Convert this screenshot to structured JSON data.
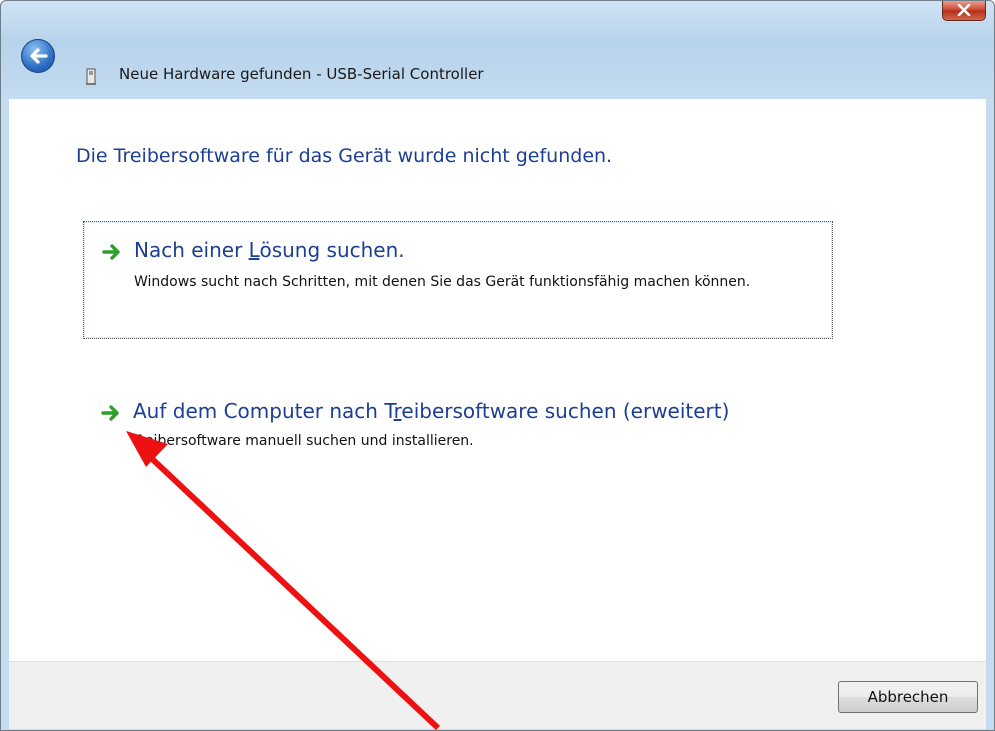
{
  "window": {
    "title": "Neue Hardware gefunden - USB-Serial Controller"
  },
  "main": {
    "heading": "Die Treibersoftware für das Gerät wurde nicht gefunden.",
    "options": [
      {
        "title_parts": [
          "Nach einer ",
          "L",
          "ösung suchen."
        ],
        "description": "Windows sucht nach Schritten, mit denen Sie das Gerät funktionsfähig machen können."
      },
      {
        "title_parts": [
          "Auf dem Computer nach T",
          "r",
          "eibersoftware suchen (erweitert)"
        ],
        "description": "Treibersoftware manuell suchen und installieren."
      }
    ]
  },
  "footer": {
    "cancel_label": "Abbrechen"
  },
  "colors": {
    "heading": "#1c3f94",
    "arrow_green": "#2f9e2a",
    "annotation_red": "#ee1111"
  },
  "icons": [
    "close-icon",
    "back-arrow-icon",
    "usb-device-icon",
    "green-arrow-icon"
  ]
}
